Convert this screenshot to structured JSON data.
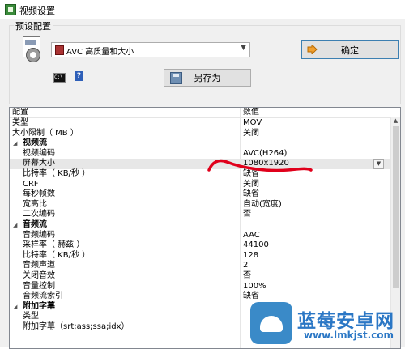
{
  "window": {
    "title": "视频设置"
  },
  "preset": {
    "group_label": "预设配置",
    "selected": "AVC 高质量和大小",
    "ok_label": "确定",
    "save_as_label": "另存为",
    "cmd_icon_text": "C:\\"
  },
  "grid": {
    "header_name": "配置",
    "header_value": "数值",
    "rows": [
      {
        "name": "类型",
        "value": "MOV",
        "level": 0,
        "category": false
      },
      {
        "name": "大小限制（ MB ）",
        "value": "关闭",
        "level": 0,
        "category": false
      },
      {
        "name": "视频流",
        "value": "",
        "level": 0,
        "category": true
      },
      {
        "name": "视频编码",
        "value": "AVC(H264)",
        "level": 1,
        "category": false
      },
      {
        "name": "屏幕大小",
        "value": "1080x1920",
        "level": 1,
        "category": false,
        "selected": true
      },
      {
        "name": "比特率（ KB/秒 ）",
        "value": "缺省",
        "level": 1,
        "category": false
      },
      {
        "name": "CRF",
        "value": "关闭",
        "level": 1,
        "category": false
      },
      {
        "name": "每秒帧数",
        "value": "缺省",
        "level": 1,
        "category": false
      },
      {
        "name": "宽高比",
        "value": "自动(宽度)",
        "level": 1,
        "category": false
      },
      {
        "name": "二次编码",
        "value": "否",
        "level": 1,
        "category": false
      },
      {
        "name": "音频流",
        "value": "",
        "level": 0,
        "category": true
      },
      {
        "name": "音频编码",
        "value": "AAC",
        "level": 1,
        "category": false
      },
      {
        "name": "采样率（ 赫兹 ）",
        "value": "44100",
        "level": 1,
        "category": false
      },
      {
        "name": "比特率（ KB/秒 ）",
        "value": "128",
        "level": 1,
        "category": false
      },
      {
        "name": "音频声道",
        "value": "2",
        "level": 1,
        "category": false
      },
      {
        "name": "关闭音效",
        "value": "否",
        "level": 1,
        "category": false
      },
      {
        "name": "音量控制",
        "value": "100%",
        "level": 1,
        "category": false
      },
      {
        "name": "音频流索引",
        "value": "缺省",
        "level": 1,
        "category": false
      },
      {
        "name": "附加字幕",
        "value": "",
        "level": 0,
        "category": true
      },
      {
        "name": "类型",
        "value": "",
        "level": 1,
        "category": false
      },
      {
        "name": "附加字幕（srt;ass;ssa;idx）",
        "value": "",
        "level": 1,
        "category": false
      }
    ]
  },
  "watermark": {
    "brand": "蓝莓安卓网",
    "url": "www.lmkjst.com"
  },
  "colors": {
    "annotation": "#e0001b",
    "ok_border": "#3c7fb1",
    "brand": "#2b77c5"
  }
}
